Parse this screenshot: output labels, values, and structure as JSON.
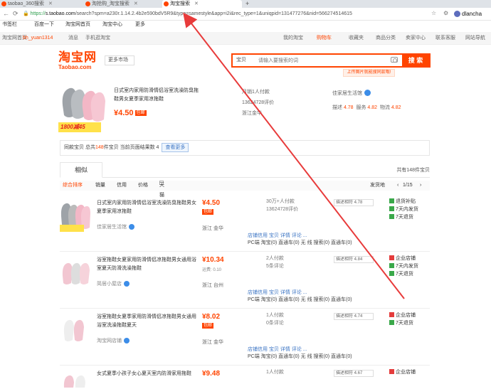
{
  "browser": {
    "tabs": [
      {
        "label": "taobao_360搜索"
      },
      {
        "label": "淘抢购_淘宝搜索"
      },
      {
        "label": "淘宝搜索"
      }
    ],
    "new_tab": "+",
    "url_scheme": "https://",
    "url_host": "s.taobao.com",
    "url_path": "/search?spm=a230r.1.14.2.4b2e590bdV5R9&type=samestyle&app=i2i&rec_type=1&uniqpid=131477276&nid=566274514615",
    "account": "dlancha",
    "bookmarks": [
      "书签栏",
      "百度一下",
      "淘宝网首页",
      "淘宝中心",
      "更多"
    ]
  },
  "sitenav": {
    "left": [
      "淘宝网首页",
      "bh_yuan1314",
      "消息",
      "手机逛淘宝"
    ],
    "right": [
      "我的淘宝",
      "购物车",
      "收藏夹",
      "商品分类",
      "卖家中心",
      "联系客服",
      "网站导航"
    ]
  },
  "header": {
    "logo_cn": "淘宝网",
    "logo_en": "Taobao.com",
    "scope_left": "更多市场",
    "scope": "宝贝",
    "search_placeholder": "请输入要搜索的词",
    "search_btn": "搜 索",
    "upload_tip": "上传图片就能搜同款哦!"
  },
  "shop": {
    "promo": "1800减45",
    "title": "日式室内家用防滑情侣浴室洗澡防臭拖鞋男女夏季家用凉拖鞋",
    "price": "¥4.50",
    "price_badge": "包邮",
    "meta": [
      "月销1人付款",
      "13624728评价",
      "浙江金华"
    ],
    "shop_name": "佳家居生活馆",
    "desc_label": "描述",
    "desc": "4.78",
    "service_label": "服务",
    "service": "4.82",
    "logistics_label": "物流",
    "logistics": "4.82"
  },
  "tip": {
    "text_a": "同款宝贝 总共",
    "count": "148",
    "text_b": "件宝贝 当前页面结果数 4",
    "link": "查看更多"
  },
  "tabs": {
    "similar": "相似",
    "count": "共有148件宝贝"
  },
  "filters": [
    "综合排序",
    "销量",
    "信用",
    "价格",
    "天猫"
  ],
  "filter_right": "发货地",
  "pager": "1/15",
  "items": [
    {
      "title": "日式室内家用防滑情侣浴室洗澡防臭拖鞋男女夏季家用凉拖鞋",
      "shop": "佳家居生活馆",
      "price": "¥4.50",
      "sub": "包邮",
      "loc": "浙江 金华",
      "sales": [
        "30万+人付款",
        "13624728评价"
      ],
      "rate": "描述相符 4.78",
      "badges": [
        "退货补贴",
        "7天内发货",
        "7天退货"
      ],
      "bar1": "店铺信用 宝贝 详情 评论 ...",
      "bar2": "PC端 淘宝(0) 直通车(0) 无 线 搜索(0) 直通车(0)"
    },
    {
      "title": "浴室拖鞋女夏家用防滑情侣凉拖鞋男女通用浴室夏天防滑洗澡拖鞋",
      "shop": "简居小屋店",
      "price": "¥10.34",
      "sub": "运费: 0.10",
      "loc": "浙江 台州",
      "sales": [
        "2人付款",
        "5条评论"
      ],
      "rate": "描述相符 4.84",
      "badges": [
        "企业店铺",
        "7天内发货",
        "7天退货"
      ],
      "bar1": "店铺信用 宝贝 详情 评论 ...",
      "bar2": "PC端 淘宝(0) 直通车(0) 无 线 搜索(0) 直通车(0)"
    },
    {
      "title": "浴室拖鞋女夏季家用防滑情侣凉拖鞋男女通用浴室洗澡拖鞋夏天",
      "shop": "淘宝网店铺",
      "price": "¥8.02",
      "sub": "包邮",
      "loc": "浙江 金华",
      "sales": [
        "1人付款",
        "0条评论"
      ],
      "rate": "描述相符 4.74",
      "badges": [
        "企业店铺",
        "7天退货"
      ],
      "bar1": "店铺信用 宝贝 详情 评论 ...",
      "bar2": "PC端 淘宝(0) 直通车(0) 无 线 搜索(0) 直通车(0)"
    },
    {
      "title": "女式夏季小孩子女心夏天室内防滑家用拖鞋",
      "shop": "",
      "price": "¥9.48",
      "sub": "",
      "loc": "",
      "sales": [
        "1人付款",
        ""
      ],
      "rate": "描述相符 4.67",
      "badges": [
        "企业店铺"
      ],
      "bar1": "",
      "bar2": ""
    }
  ],
  "colors": {
    "brand": "#ff4400",
    "arrow": "#e83b3b"
  }
}
